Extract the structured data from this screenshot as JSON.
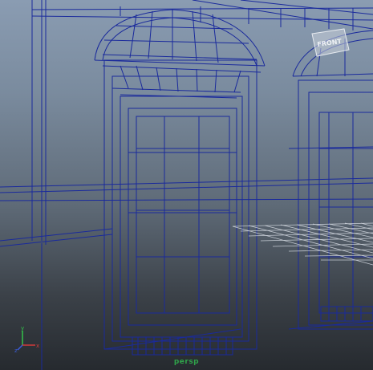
{
  "viewport": {
    "camera_name": "persp",
    "background_top": "#8a9cb2",
    "background_bottom": "#262a2f",
    "wire_color": "#1a2a9c",
    "grid_color": "#d9dee6"
  },
  "view_cube": {
    "face_label": "FRONT"
  },
  "axis_gizmo": {
    "x_label": "x",
    "y_label": "y",
    "z_label": "z"
  }
}
